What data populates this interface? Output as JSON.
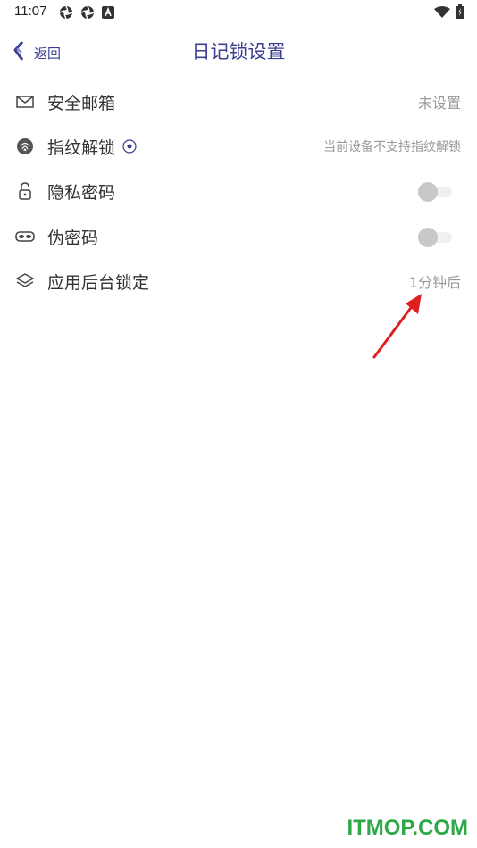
{
  "status_bar": {
    "time": "11:07"
  },
  "header": {
    "back_label": "返回",
    "title": "日记锁设置"
  },
  "settings": [
    {
      "label": "安全邮箱",
      "value": "未设置",
      "icon": "mail-icon"
    },
    {
      "label": "指纹解锁",
      "value": "当前设备不支持指纹解锁",
      "icon": "fingerprint-icon"
    },
    {
      "label": "隐私密码",
      "toggle": false,
      "icon": "lock-icon"
    },
    {
      "label": "伪密码",
      "toggle": false,
      "icon": "mask-icon"
    },
    {
      "label": "应用后台锁定",
      "value": "1分钟后",
      "icon": "layers-icon"
    }
  ],
  "colors": {
    "accent": "#3b3f8f",
    "arrow": "#e02020",
    "watermark": "#2fa84a"
  },
  "watermark": "ITMOP.COM"
}
